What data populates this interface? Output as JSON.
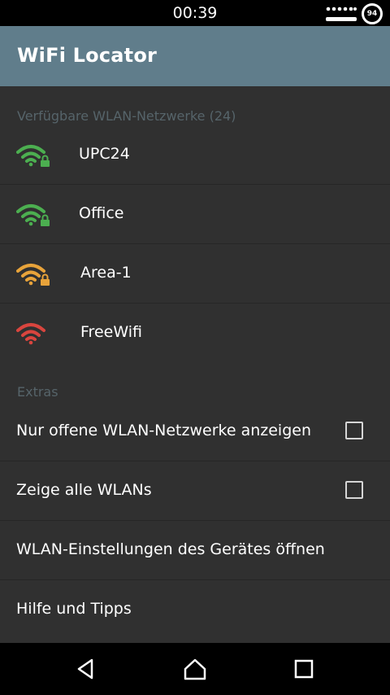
{
  "status_bar": {
    "time": "00:39",
    "battery_level": "94",
    "icons": [
      "signal-icon",
      "battery-icon"
    ]
  },
  "app_bar": {
    "title": "WiFi Locator",
    "color": "#607d8b"
  },
  "networks": {
    "header": "Verfügbare WLAN-Netzwerke (24)",
    "items": [
      {
        "name": "UPC24",
        "strength": "strong",
        "color": "#4caf50",
        "locked": true
      },
      {
        "name": "Office",
        "strength": "strong",
        "color": "#4caf50",
        "locked": true
      },
      {
        "name": "Area-1",
        "strength": "medium",
        "color": "#e8a33a",
        "locked": true
      },
      {
        "name": "FreeWifi",
        "strength": "weak",
        "color": "#d9453e",
        "locked": false
      }
    ]
  },
  "extras": {
    "header": "Extras",
    "items": [
      {
        "label": "Nur offene WLAN-Netzwerke anzeigen",
        "checkbox": true,
        "checked": false
      },
      {
        "label": "Zeige alle WLANs",
        "checkbox": true,
        "checked": false
      },
      {
        "label": "WLAN-Einstellungen des Gerätes öffnen",
        "checkbox": false
      },
      {
        "label": "Hilfe und Tipps",
        "checkbox": false
      }
    ]
  },
  "nav": {
    "icons": [
      "back-icon",
      "home-icon",
      "recents-icon"
    ]
  }
}
